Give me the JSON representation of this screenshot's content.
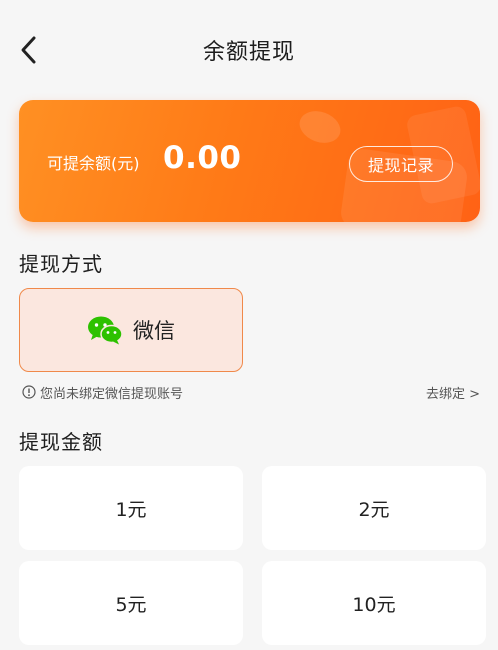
{
  "header": {
    "title": "余额提现",
    "back_icon": "chevron-left-icon"
  },
  "balance": {
    "label": "可提余额(元)",
    "value": "0.00",
    "record_button": "提现记录"
  },
  "method_section": {
    "title": "提现方式",
    "methods": [
      {
        "label": "微信",
        "icon": "wechat-icon",
        "selected": true
      }
    ],
    "notice": "您尚未绑定微信提现账号",
    "bind_link": "去绑定 >"
  },
  "amount_section": {
    "title": "提现金额",
    "options": [
      "1元",
      "2元",
      "5元",
      "10元"
    ]
  },
  "colors": {
    "accent": "#ff7a17",
    "selected_border": "#f0894a",
    "selected_bg": "#fbe7df",
    "wechat_green": "#2dc100"
  }
}
